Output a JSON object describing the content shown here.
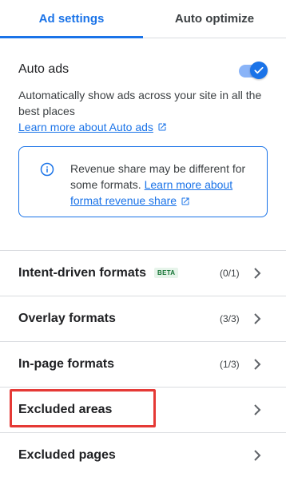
{
  "tabs": [
    {
      "label": "Ad settings",
      "active": true
    },
    {
      "label": "Auto optimize",
      "active": false
    }
  ],
  "auto_ads": {
    "title": "Auto ads",
    "toggle_on": true,
    "description": "Automatically show ads across your site in all the best places",
    "learn_more": "Learn more about Auto ads"
  },
  "info": {
    "text_prefix": "Revenue share may be different for some formats.",
    "link": "Learn more about format revenue share"
  },
  "rows": [
    {
      "label": "Intent-driven formats",
      "badge": "BETA",
      "count": "(0/1)"
    },
    {
      "label": "Overlay formats",
      "count": "(3/3)"
    },
    {
      "label": "In-page formats",
      "count": "(1/3)"
    },
    {
      "label": "Excluded areas"
    },
    {
      "label": "Excluded pages"
    }
  ],
  "colors": {
    "accent": "#1a73e8",
    "highlight": "#e53935",
    "beta_text": "#137333",
    "beta_bg": "#e6f4ea"
  },
  "icons": {
    "info": "info-icon",
    "external_link": "open-in-new-icon",
    "chevron": "chevron-right-icon",
    "check": "check-icon"
  }
}
